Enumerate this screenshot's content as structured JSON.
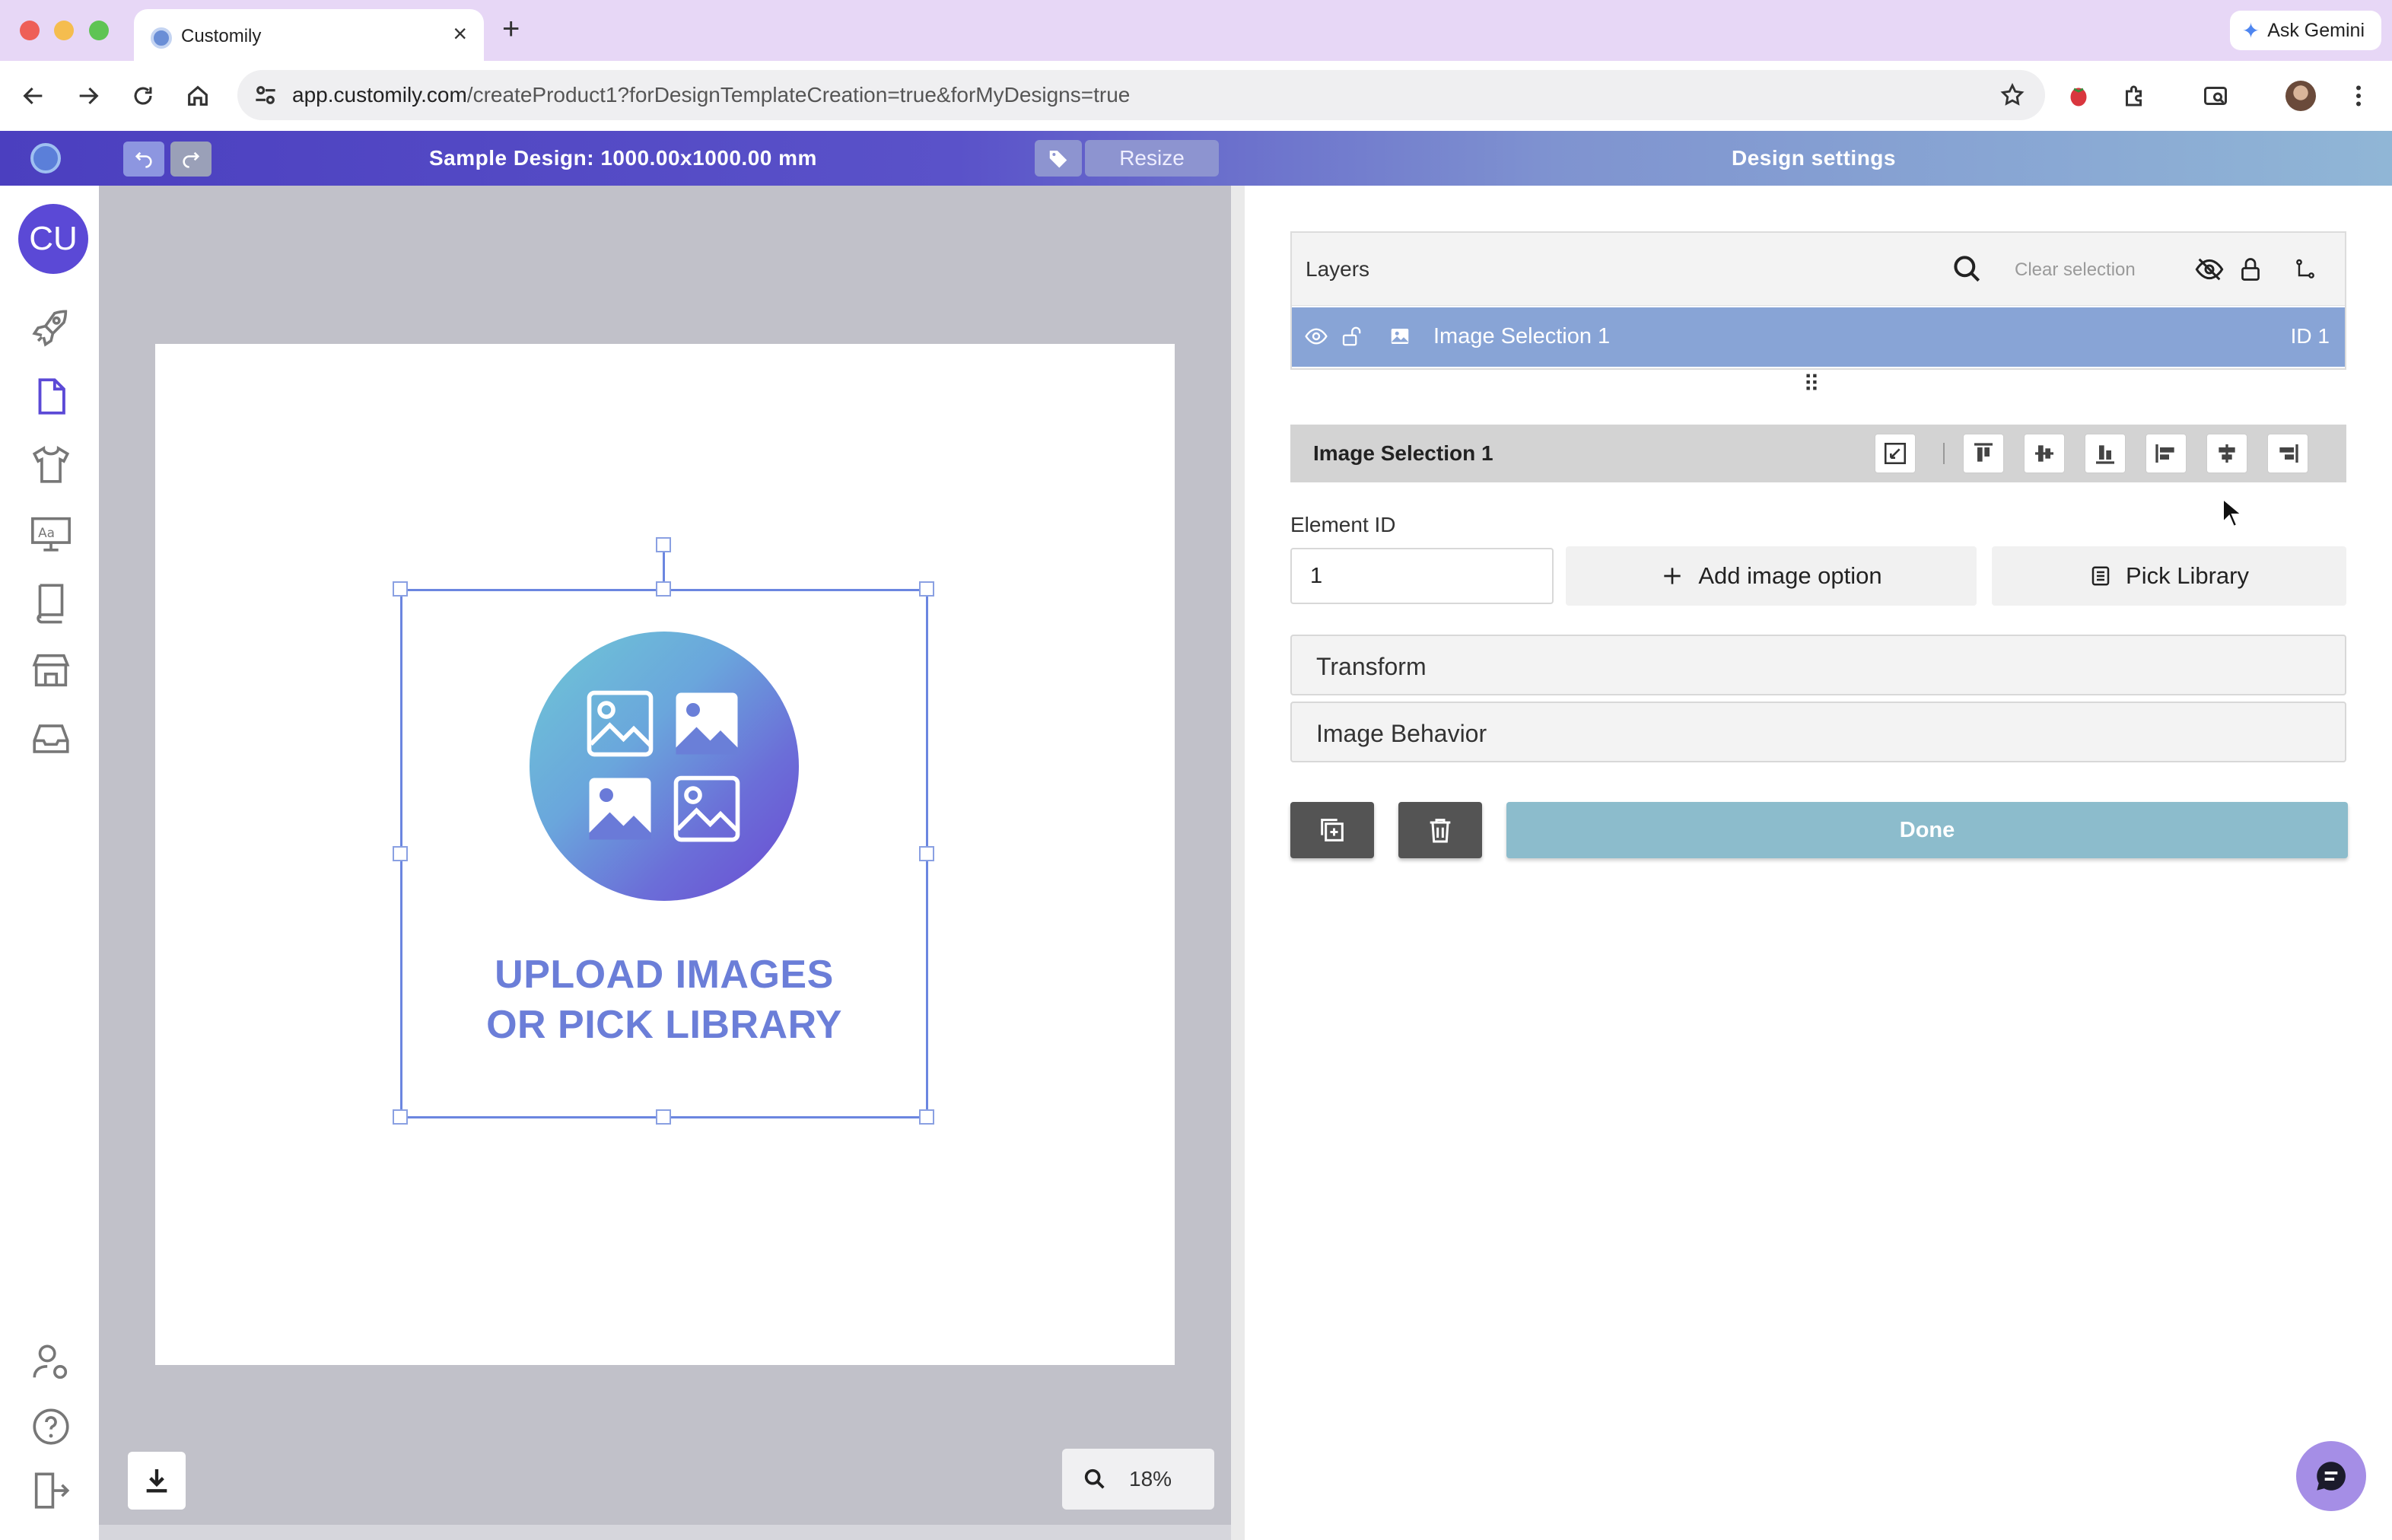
{
  "browser": {
    "tab_title": "Customily",
    "tab_close": "×",
    "new_tab": "+",
    "ask_gemini": "Ask Gemini",
    "url_host": "app.customily.com",
    "url_path": "/createProduct1?forDesignTemplateCreation=true&forMyDesigns=true"
  },
  "header": {
    "undo_icon": "undo-icon",
    "redo_icon": "redo-icon",
    "design_title": "Sample Design: 1000.00x1000.00 mm",
    "resize_label": "Resize",
    "settings_title": "Design settings"
  },
  "sidebar": {
    "avatar_initials": "CU",
    "items": [
      "rocket-icon",
      "document-icon",
      "tshirt-icon",
      "design-monitor-icon",
      "book-icon",
      "store-icon",
      "inbox-icon"
    ],
    "bottom_items": [
      "user-settings-icon",
      "help-icon",
      "logout-icon"
    ]
  },
  "canvas": {
    "upload_line1": "UPLOAD IMAGES",
    "upload_line2": "OR PICK LIBRARY",
    "zoom": "18%"
  },
  "layers": {
    "title": "Layers",
    "clear_selection": "Clear selection",
    "rows": [
      {
        "name": "Image Selection 1",
        "id": "ID 1"
      }
    ]
  },
  "element": {
    "title": "Image Selection 1",
    "id_label": "Element ID",
    "id_value": "1",
    "add_option_label": "Add image option",
    "pick_library_label": "Pick Library",
    "transform_label": "Transform",
    "behavior_label": "Image Behavior",
    "done_label": "Done"
  },
  "colors": {
    "accent": "#5b49d6",
    "layer_selected": "#88a4d6",
    "done": "#8cbccc",
    "upload_text": "#6b7ed8"
  }
}
